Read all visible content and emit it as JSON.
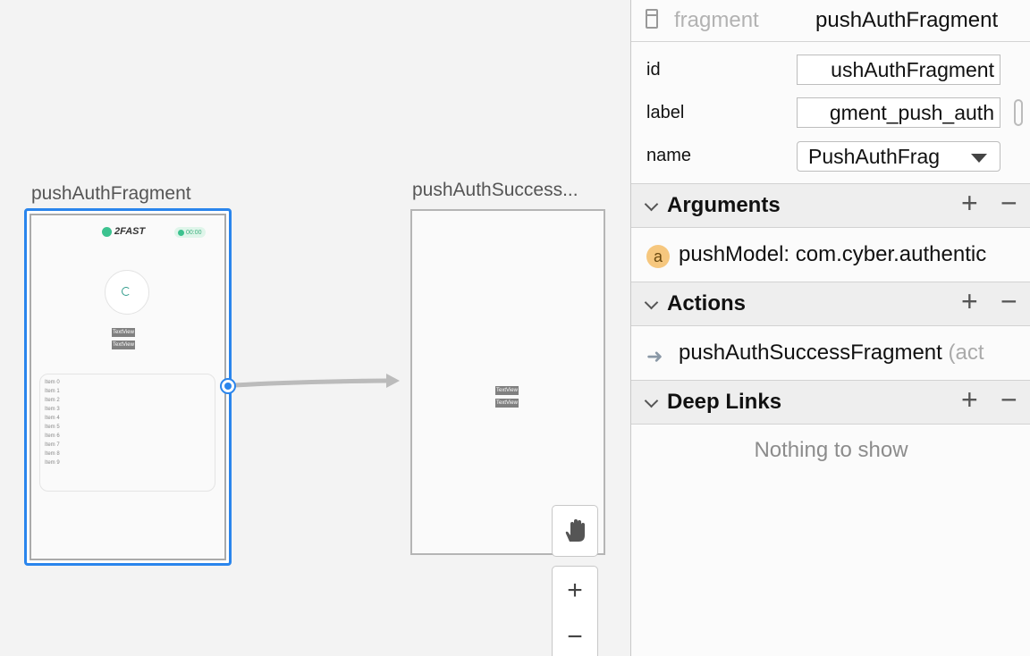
{
  "canvas": {
    "nodes": [
      {
        "title": "pushAuthFragment",
        "selected": true,
        "preview": {
          "logo_text": "2FAST",
          "timer": "00:00",
          "text_views": [
            "TextView",
            "TextView"
          ],
          "list_items": [
            "Item 0",
            "Item 1",
            "Item 2",
            "Item 3",
            "Item 4",
            "Item 5",
            "Item 6",
            "Item 7",
            "Item 8",
            "Item 9"
          ]
        }
      },
      {
        "title": "pushAuthSuccess...",
        "selected": false,
        "preview": {
          "text_views": [
            "TextView",
            "TextView"
          ]
        }
      }
    ],
    "tools": {
      "pan_icon": "hand-icon",
      "zoom_in": "+",
      "zoom_out": "−"
    },
    "colors": {
      "selection": "#2a85ec",
      "edge": "#bbbbbb"
    }
  },
  "panel": {
    "header": {
      "type": "fragment",
      "name": "pushAuthFragment",
      "icon": "fragment-icon"
    },
    "attributes": {
      "id": {
        "label": "id",
        "value": "ushAuthFragment"
      },
      "label": {
        "label": "label",
        "value": "gment_push_auth"
      },
      "name": {
        "label": "name",
        "value": "PushAuthFrag"
      }
    },
    "sections": {
      "arguments": {
        "title": "Arguments",
        "items": [
          {
            "badge": "a",
            "text": "pushModel: com.cyber.authentic"
          }
        ]
      },
      "actions": {
        "title": "Actions",
        "items": [
          {
            "text": "pushAuthSuccessFragment",
            "suffix": "(act"
          }
        ]
      },
      "deep_links": {
        "title": "Deep Links",
        "empty_text": "Nothing to show"
      }
    },
    "add_label": "+",
    "remove_label": "−"
  }
}
